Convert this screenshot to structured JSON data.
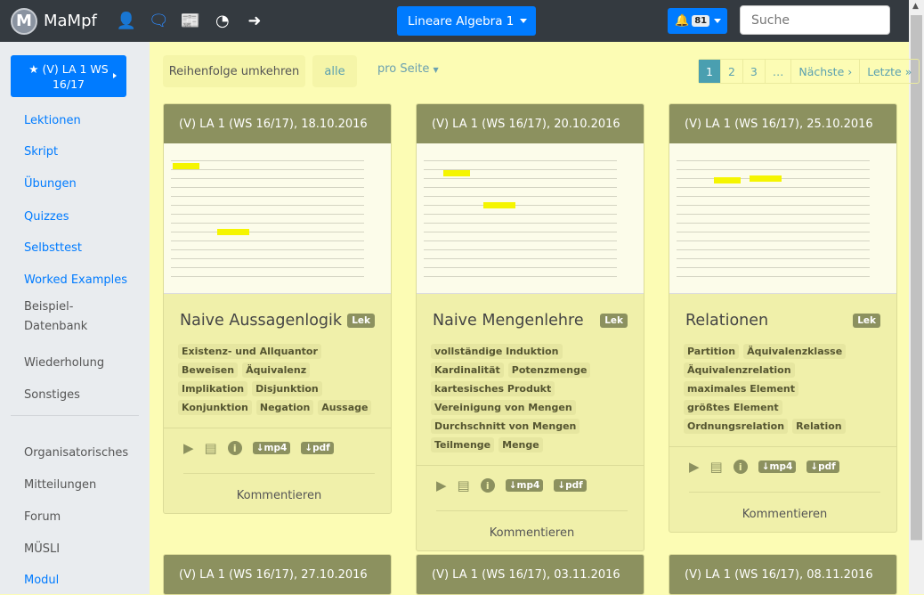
{
  "nav": {
    "brand": "MaMpf",
    "course": "Lineare Algebra 1",
    "notifications": "81",
    "search_placeholder": "Suche",
    "icons": [
      "user-gear-icon",
      "comments-icon",
      "newspaper-icon",
      "podcast-icon",
      "sign-out-icon"
    ]
  },
  "sidebar": {
    "lecture": "★ (V) LA 1 WS 16/17",
    "items": [
      {
        "label": "Lektionen",
        "active": true
      },
      {
        "label": "Skript",
        "active": true
      },
      {
        "label": "Übungen",
        "active": true
      },
      {
        "label": "Quizzes",
        "active": true
      },
      {
        "label": "Selbsttest",
        "active": true
      },
      {
        "label": "Worked Examples",
        "active": true
      },
      {
        "label": "Beispiel-Datenbank",
        "active": false
      },
      {
        "label": "Wiederholung",
        "active": false
      },
      {
        "label": "Sonstiges",
        "active": false
      }
    ],
    "items2": [
      {
        "label": "Organisatorisches",
        "active": false
      },
      {
        "label": "Mitteilungen",
        "active": false
      },
      {
        "label": "Forum",
        "active": false
      },
      {
        "label": "MÜSLI",
        "active": false
      },
      {
        "label": "Modul",
        "active": true
      }
    ]
  },
  "toolbar": {
    "reverse": "Reihenfolge umkehren",
    "all": "alle",
    "per_page": "pro Seite"
  },
  "pagination": [
    "1",
    "2",
    "3",
    "…",
    "Nächste ›",
    "Letzte »"
  ],
  "cards": [
    {
      "header": "(V) LA 1 (WS 16/17), 18.10.2016",
      "title": "Naive Aussagenlogik",
      "badge": "Lek",
      "tags": [
        "Existenz- und Allquantor",
        "Beweisen",
        "Äquivalenz",
        "Implikation",
        "Disjunktion",
        "Konjunktion",
        "Negation",
        "Aussage"
      ],
      "mp4": "↓mp4",
      "pdf": "↓pdf",
      "comment": "Kommentieren"
    },
    {
      "header": "(V) LA 1 (WS 16/17), 20.10.2016",
      "title": "Naive Mengenlehre",
      "badge": "Lek",
      "tags": [
        "vollständige Induktion",
        "Kardinalität",
        "Potenzmenge",
        "kartesisches Produkt",
        "Vereinigung von Mengen",
        "Durchschnitt von Mengen",
        "Teilmenge",
        "Menge"
      ],
      "mp4": "↓mp4",
      "pdf": "↓pdf",
      "comment": "Kommentieren"
    },
    {
      "header": "(V) LA 1 (WS 16/17), 25.10.2016",
      "title": "Relationen",
      "badge": "Lek",
      "tags": [
        "Partition",
        "Äquivalenzklasse",
        "Äquivalenzrelation",
        "maximales Element",
        "größtes Element",
        "Ordnungsrelation",
        "Relation"
      ],
      "mp4": "↓mp4",
      "pdf": "↓pdf",
      "comment": "Kommentieren"
    }
  ],
  "next_cards": [
    "(V) LA 1 (WS 16/17), 27.10.2016",
    "(V) LA 1 (WS 16/17), 03.11.2016",
    "(V) LA 1 (WS 16/17), 08.11.2016"
  ]
}
